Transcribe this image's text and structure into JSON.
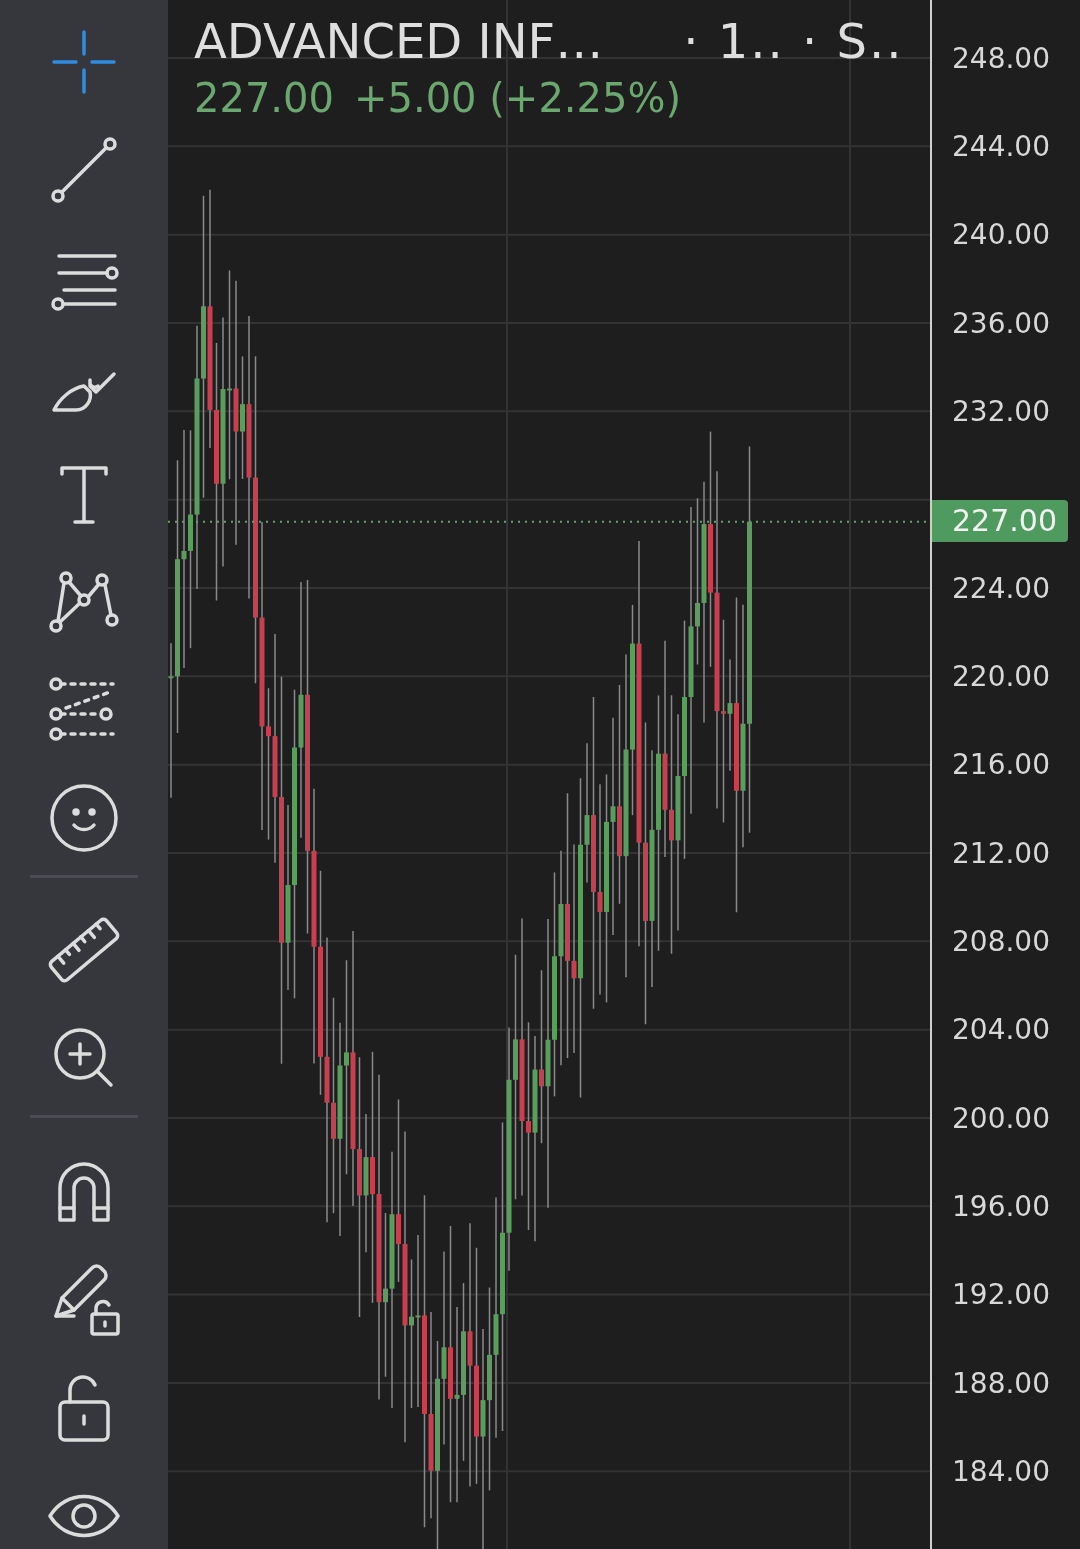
{
  "header": {
    "symbol": "ADVANCED INF…",
    "meta": "· 1.. · S..",
    "price": "227.00",
    "change": "+5.00 (+2.25%)"
  },
  "toolbar": {
    "groups": [
      {
        "tools": [
          {
            "kind": "crosshair",
            "selected": true
          },
          {
            "kind": "line",
            "selected": false
          },
          {
            "kind": "channel",
            "selected": false
          },
          {
            "kind": "brush",
            "selected": false
          },
          {
            "kind": "text",
            "selected": false
          },
          {
            "kind": "pattern",
            "selected": false
          },
          {
            "kind": "projection",
            "selected": false
          },
          {
            "kind": "emoji",
            "selected": false
          }
        ]
      },
      {
        "tools": [
          {
            "kind": "ruler",
            "selected": false
          },
          {
            "kind": "zoom",
            "selected": false
          }
        ]
      },
      {
        "tools": [
          {
            "kind": "magnet",
            "selected": false
          },
          {
            "kind": "lock-drawings",
            "selected": false
          },
          {
            "kind": "lock",
            "selected": false
          },
          {
            "kind": "eye",
            "selected": false
          }
        ]
      }
    ]
  },
  "price_axis": {
    "ticks": [
      {
        "kind": "tick",
        "label": "248.00"
      },
      {
        "kind": "tick",
        "label": "244.00"
      },
      {
        "kind": "tick",
        "label": "240.00"
      },
      {
        "kind": "tick",
        "label": "236.00"
      },
      {
        "kind": "tick",
        "label": "232.00"
      },
      {
        "kind": "current-price",
        "label": "227.00"
      },
      {
        "kind": "tick",
        "label": "224.00"
      },
      {
        "kind": "tick",
        "label": "220.00"
      },
      {
        "kind": "tick",
        "label": "216.00"
      },
      {
        "kind": "tick",
        "label": "212.00"
      },
      {
        "kind": "tick",
        "label": "208.00"
      },
      {
        "kind": "tick",
        "label": "204.00"
      },
      {
        "kind": "tick",
        "label": "200.00"
      },
      {
        "kind": "tick",
        "label": "196.00"
      },
      {
        "kind": "tick",
        "label": "192.00"
      },
      {
        "kind": "tick",
        "label": "188.00"
      },
      {
        "kind": "tick",
        "label": "184.00"
      }
    ]
  }
}
